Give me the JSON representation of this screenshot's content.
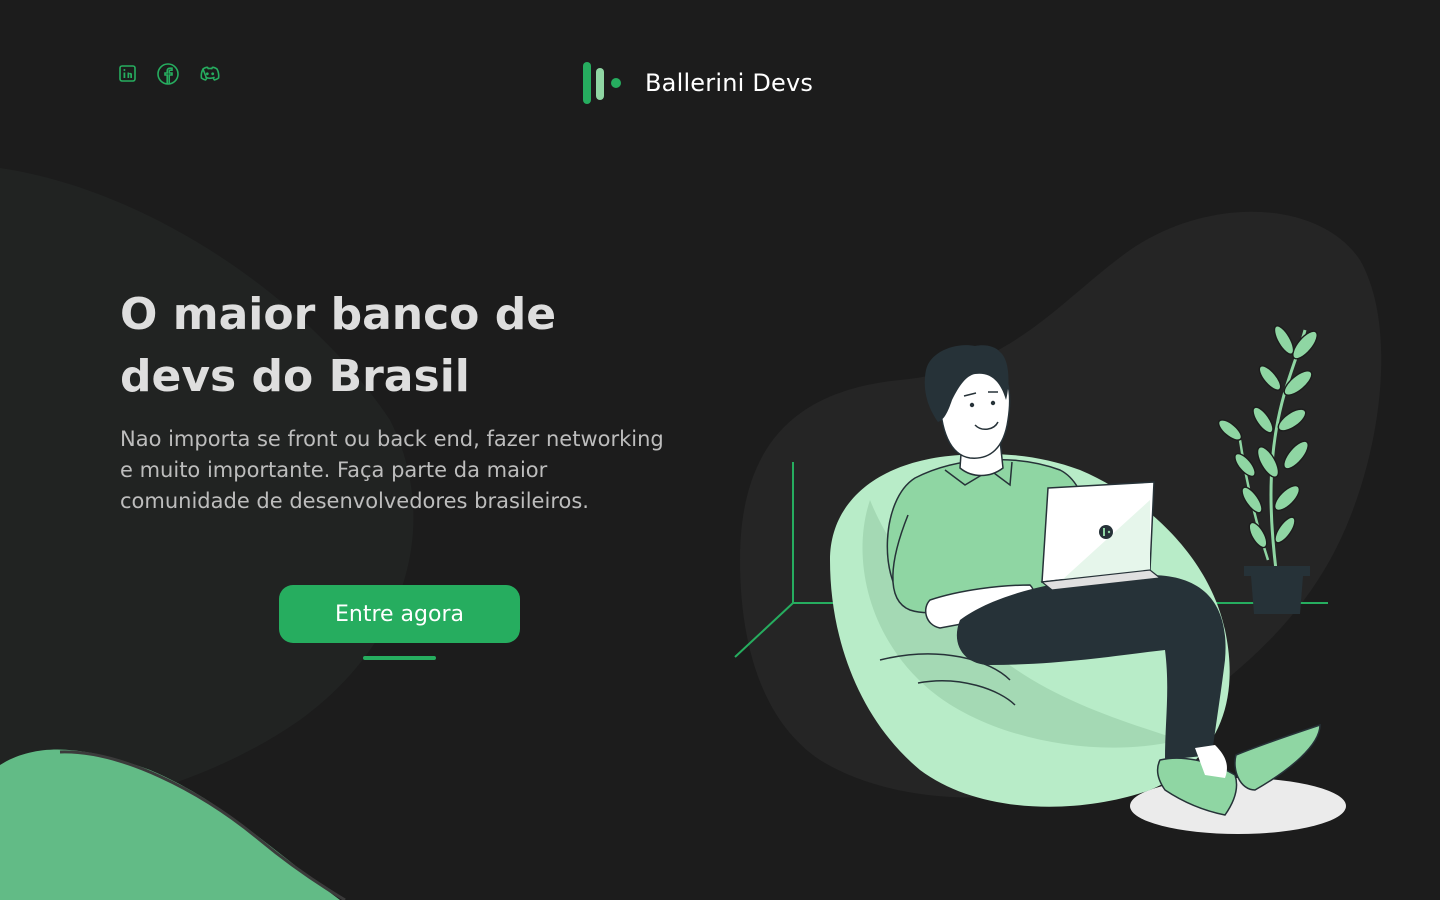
{
  "brand": {
    "name": "Ballerini Devs"
  },
  "social_links": [
    {
      "icon": "linkedin-icon"
    },
    {
      "icon": "facebook-icon"
    },
    {
      "icon": "discord-icon"
    }
  ],
  "hero": {
    "title": "O maior banco de devs do Brasil",
    "description": "Nao importa se front ou back end, fazer networking e muito importante. Faça parte da maior comunidade de desenvolvedores brasileiros.",
    "cta_label": "Entre agora"
  },
  "colors": {
    "background": "#1c1c1c",
    "accent": "#26ad5f",
    "accent_light": "#8fd6a3",
    "text_primary": "#dedede",
    "text_secondary": "#bdbdbd"
  }
}
